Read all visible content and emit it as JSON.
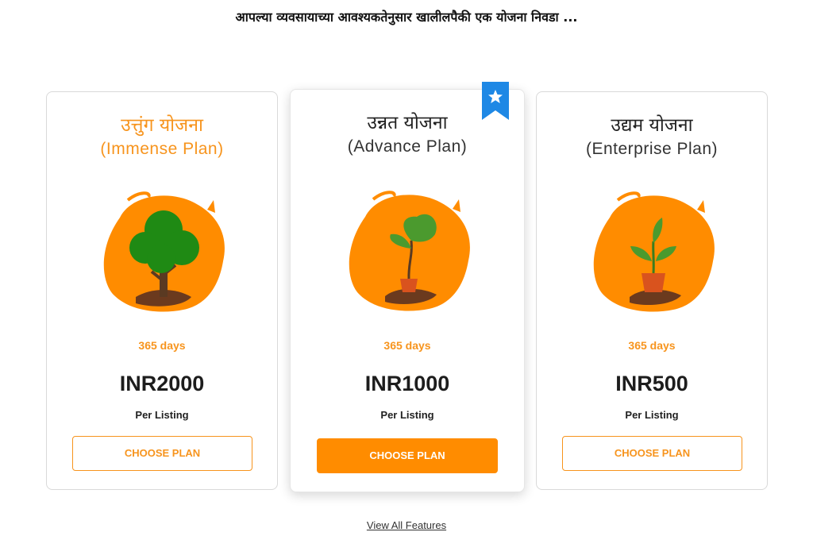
{
  "heading": "आपल्या व्यवसायाच्या आवश्यकतेनुसार खालीलपैकी एक योजना निवडा ...",
  "plans": [
    {
      "name_mr": "उत्तुंग योजना",
      "name_en": "(Immense Plan)",
      "duration": "365 days",
      "price": "INR2000",
      "per": "Per Listing",
      "button": "CHOOSE PLAN"
    },
    {
      "name_mr": "उन्नत योजना",
      "name_en": "(Advance Plan)",
      "duration": "365 days",
      "price": "INR1000",
      "per": "Per Listing",
      "button": "CHOOSE PLAN",
      "featured": true
    },
    {
      "name_mr": "उद्यम योजना",
      "name_en": "(Enterprise Plan)",
      "duration": "365 days",
      "price": "INR500",
      "per": "Per Listing",
      "button": "CHOOSE PLAN"
    }
  ],
  "footer_link": "View All Features",
  "colors": {
    "accent": "#f7941d",
    "button_fill": "#ff8c00",
    "ribbon": "#1e88e5"
  },
  "icons": {
    "ribbon": "star-ribbon-icon",
    "plan_1": "big-tree-icon",
    "plan_2": "sapling-icon",
    "plan_3": "seedling-pot-icon"
  }
}
